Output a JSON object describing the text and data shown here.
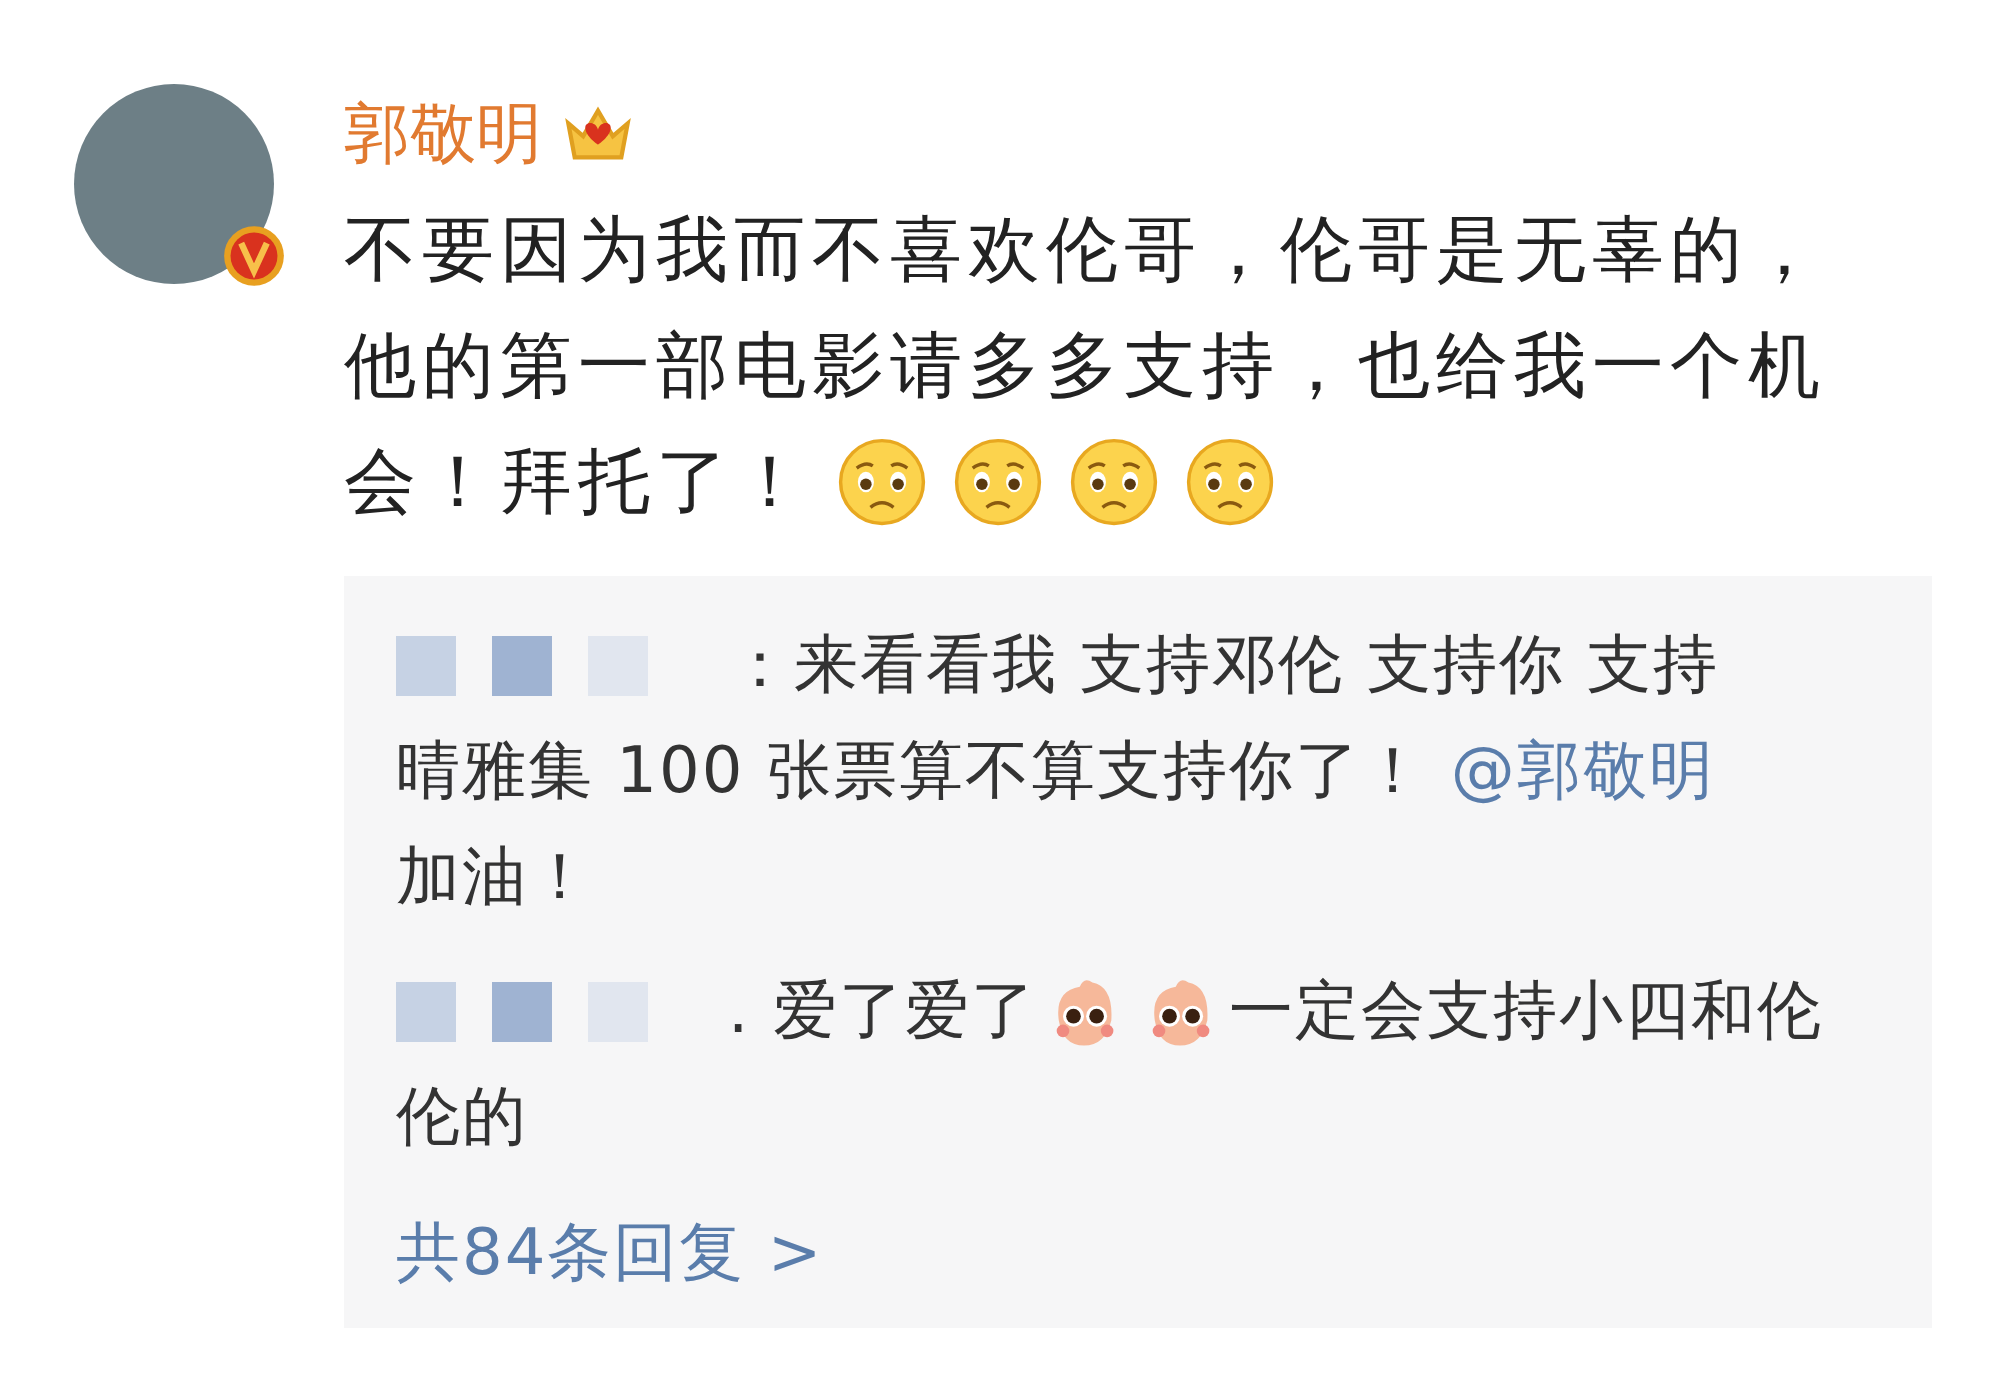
{
  "post": {
    "author": "郭敬明",
    "verified": true,
    "crown": true,
    "lines": [
      [
        {
          "kind": "text",
          "text": "不要因为我而不喜欢伦哥，伦哥是无辜的，"
        }
      ],
      [
        {
          "kind": "text",
          "text": "他的第一部电影请多多支持，也给我一个机"
        }
      ],
      [
        {
          "kind": "text",
          "text": "会！拜托了！"
        },
        {
          "kind": "emoji"
        },
        {
          "kind": "emoji"
        },
        {
          "kind": "emoji"
        },
        {
          "kind": "emoji"
        }
      ]
    ]
  },
  "replies": [
    {
      "lines": [
        [
          {
            "kind": "blurred-name"
          },
          {
            "kind": "text",
            "text": "：来看看我 支持邓伦 支持你 支持"
          }
        ],
        [
          {
            "kind": "text",
            "text": "晴雅集 100 张票算不算支持你了！"
          },
          {
            "kind": "mention",
            "text": "@郭敬明"
          }
        ],
        [
          {
            "kind": "text",
            "text": "加油！"
          }
        ]
      ]
    },
    {
      "lines": [
        [
          {
            "kind": "blurred-name"
          },
          {
            "kind": "text",
            "text": ". 爱了爱了"
          },
          {
            "kind": "sticker"
          },
          {
            "kind": "sticker"
          },
          {
            "kind": "text",
            "text": "一定会支持小四和伦"
          }
        ],
        [
          {
            "kind": "text",
            "text": "伦的"
          }
        ]
      ]
    }
  ],
  "more_replies": "共84条回复 >"
}
